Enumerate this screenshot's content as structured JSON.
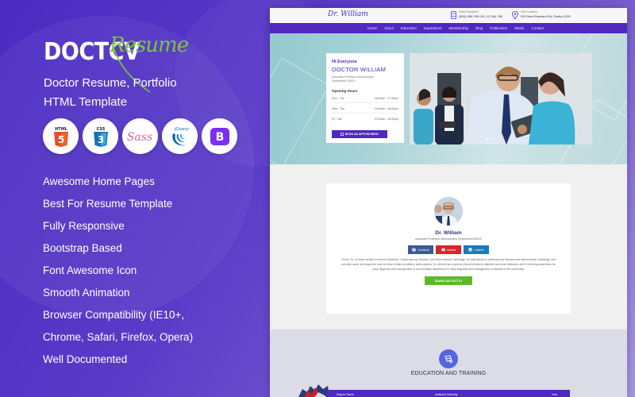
{
  "promo": {
    "brand_main": "DOCTCV",
    "brand_script": "Resume",
    "tagline_line1": "Doctor Resume, Portfolio",
    "tagline_line2": "HTML Template",
    "tech_badges": [
      {
        "name": "html5-icon",
        "label": "HTML",
        "color": "#e44d26"
      },
      {
        "name": "css3-icon",
        "label": "CSS",
        "color": "#1b73ba"
      },
      {
        "name": "sass-icon",
        "label": "Sass",
        "color": "#cd6799"
      },
      {
        "name": "jquery-icon",
        "label": "jQuery",
        "color": "#0868ac"
      },
      {
        "name": "bootstrap-icon",
        "label": "B",
        "color": "#7b2ff2"
      }
    ],
    "features": [
      "Awesome Home Pages",
      "Best For Resume Template",
      "Fully Responsive",
      "Bootstrap Based",
      "Font Awesome Icon",
      "Smooth Animation",
      "Browser Compatibility (IE10+,",
      "Chrome, Safari, Firefox, Opera)",
      "Well Documented"
    ]
  },
  "mockup": {
    "logo": "Dr. William",
    "contact_phone": {
      "label": "Have Question?",
      "value": "(800) 656-789 091, 02 264 789"
    },
    "contact_location": {
      "label": "Visit Location",
      "value": "295 New Elephant Rd, Dhaka 1205"
    },
    "nav": [
      "Home",
      "About",
      "Education",
      "Experience",
      "Membership",
      "Blog",
      "Publication",
      "Media",
      "Contact"
    ],
    "hero": {
      "greeting": "Hi Everyone",
      "name": "DOCTOR WILLIAM",
      "role": "Associate Professor Neurosurgery Department DMCH",
      "opening_hours_title": "Opening Hours",
      "hours": [
        {
          "days": "Mon - Tue",
          "time": "08:00am - 07:30pm"
        },
        {
          "days": "Wed - Thu",
          "time": "09:00am - 06:00pm"
        },
        {
          "days": "Fri - Sat",
          "time": "10:30am - 08:00pm"
        }
      ],
      "appointment_button": "BOOK AN APPOINTMENT"
    },
    "profile": {
      "name": "Dr. William",
      "role": "Associate Professor Neurosurgery Department DMCH",
      "social": [
        {
          "name": "facebook",
          "label": "Facebook",
          "color": "#3b5998"
        },
        {
          "name": "youtube",
          "label": "Youtube",
          "color": "#d9252a"
        },
        {
          "name": "linkedin",
          "label": "Linkedin",
          "color": "#1a7bb9"
        }
      ],
      "bio": "Doctor, Dr. is board certified in Internal Medicine, Cardiovascular Disease, and Interventional Cardiology. He specializes in cardiovascular disease and interventional cardiology, and provides acute and long-term care for heart related conditions adult patients. Dr. Ahmed has a special clinical interest in diabetes and heart diseases, and in fostering awareness for early diagnosis and management of and scholarly awareness for early diagnosis and management of disease in the community.",
      "download_button": "DOWNLOAD DOCTCV"
    },
    "education": {
      "title": "EDUCATION AND TRAINING",
      "table_headers": [
        "Degree Name",
        "Institute/University",
        "Year"
      ]
    }
  },
  "colors": {
    "accent": "#5028c0",
    "green": "#7cc63a",
    "download_green": "#5fb82a"
  }
}
